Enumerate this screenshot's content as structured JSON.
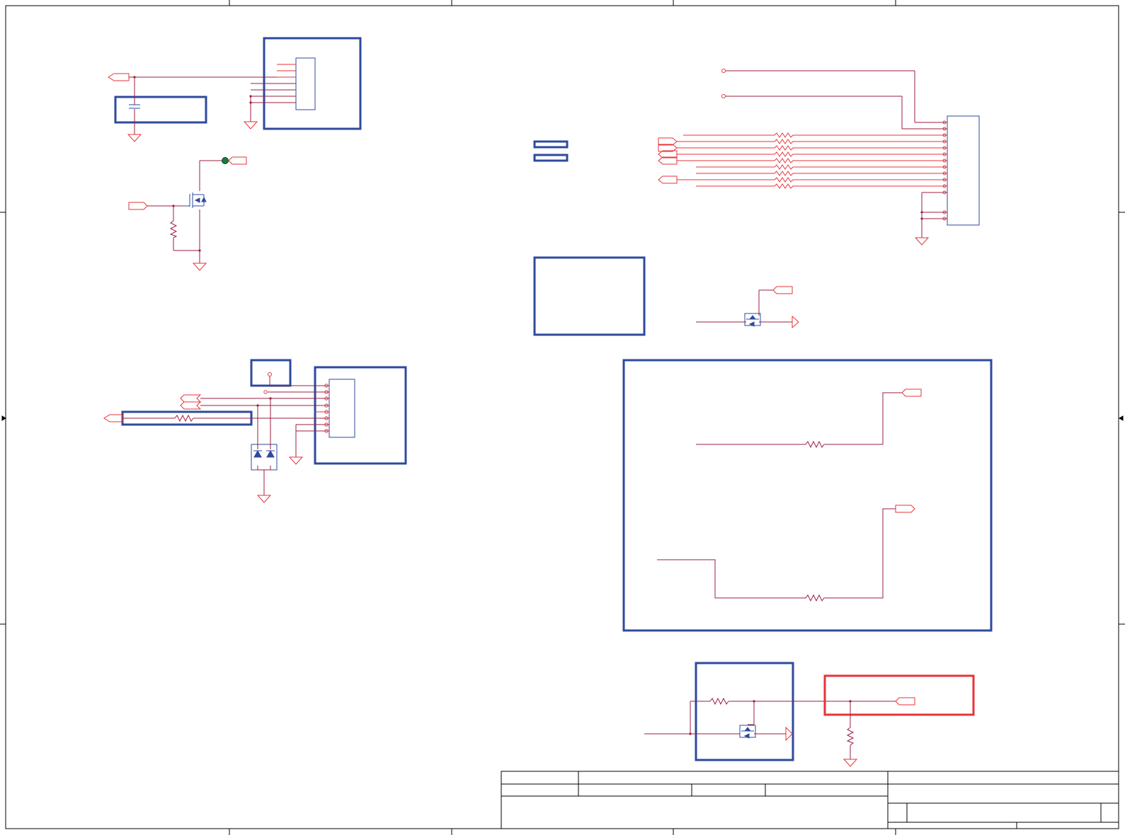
{
  "colors": {
    "frame": "#000000",
    "block_outline": "#2e4a9e",
    "component": "#2e4a9e",
    "wire": "#9b1f3f",
    "net_label": "#e8333a",
    "highlight": "#e8333a",
    "test_point": "#1a7a3a"
  },
  "sheet": {
    "frame": "drawing-frame",
    "title_block": "empty-title-block"
  },
  "blocks": [
    {
      "name": "connector-block-top-left",
      "kind": "connector",
      "pins": 8
    },
    {
      "name": "capacitor-group-box",
      "kind": "passive-group"
    },
    {
      "name": "mosfet-switch-left",
      "kind": "mosfet"
    },
    {
      "name": "small-label-box-left",
      "kind": "placeholder"
    },
    {
      "name": "connector-block-mid-left",
      "kind": "connector",
      "pins": 9
    },
    {
      "name": "resistor-group-box",
      "kind": "passive-group"
    },
    {
      "name": "tvs-diode-pair",
      "kind": "diode-array"
    },
    {
      "name": "jumper-bars",
      "kind": "jumper"
    },
    {
      "name": "empty-note-box",
      "kind": "placeholder"
    },
    {
      "name": "connector-right",
      "kind": "connector",
      "pins": 16
    },
    {
      "name": "series-resistor-bank",
      "kind": "resistor-array",
      "count": 9
    },
    {
      "name": "mosfet-switch-center",
      "kind": "mosfet"
    },
    {
      "name": "large-resistor-block",
      "kind": "passive-group"
    },
    {
      "name": "mosfet-switch-bottom-block",
      "kind": "mosfet"
    },
    {
      "name": "highlighted-pulldown-block",
      "kind": "passive-group"
    }
  ]
}
